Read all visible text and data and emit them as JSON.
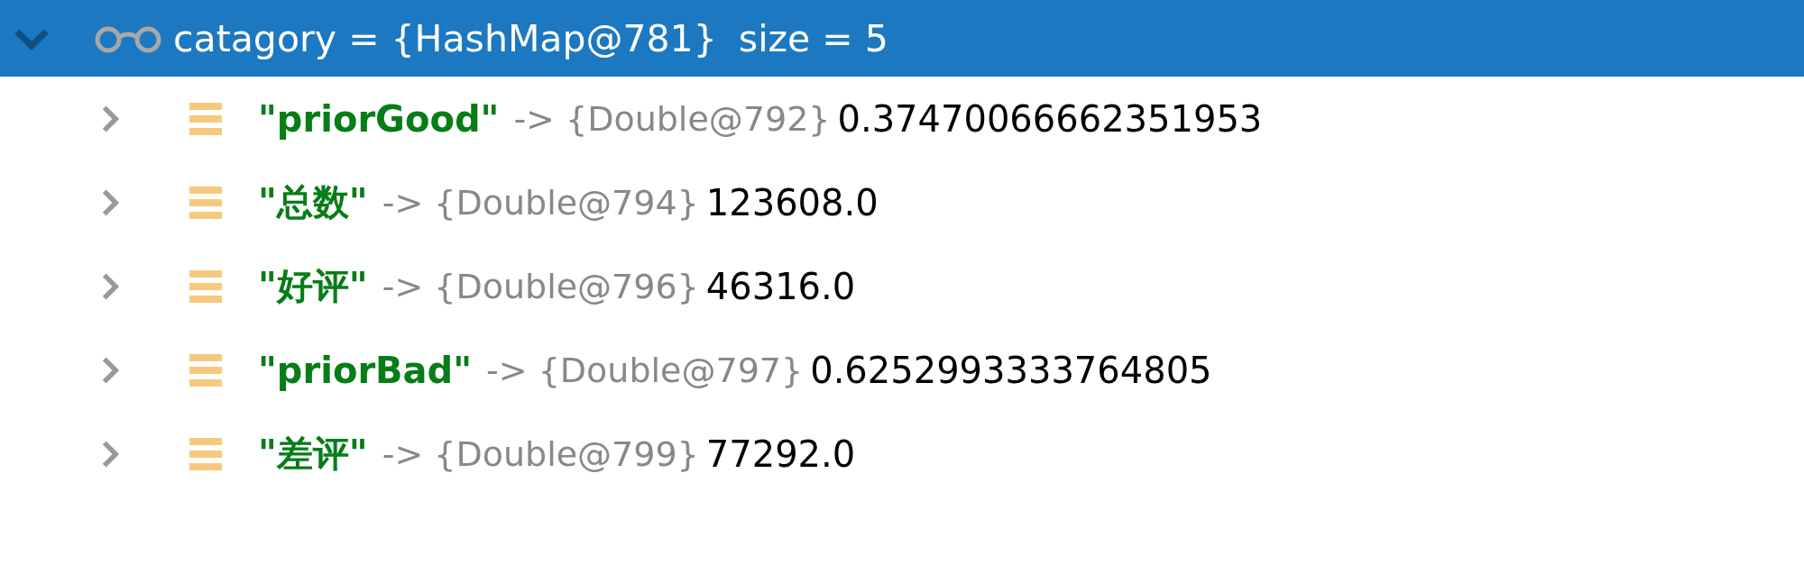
{
  "variable": {
    "label": "catagory = {HashMap@781}",
    "extra": "size = 5",
    "expanded": true,
    "selected": true,
    "children": [
      {
        "key": "\"priorGood\"",
        "arrow": "->",
        "ref": "{Double@792}",
        "value": "0.37470066662351953",
        "expanded": false
      },
      {
        "key": "\"总数\"",
        "arrow": "->",
        "ref": "{Double@794}",
        "value": "123608.0",
        "expanded": false
      },
      {
        "key": "\"好评\"",
        "arrow": "->",
        "ref": "{Double@796}",
        "value": "46316.0",
        "expanded": false
      },
      {
        "key": "\"priorBad\"",
        "arrow": "->",
        "ref": "{Double@797}",
        "value": "0.6252993333764805",
        "expanded": false
      },
      {
        "key": "\"差评\"",
        "arrow": "->",
        "ref": "{Double@799}",
        "value": "77292.0",
        "expanded": false
      }
    ]
  }
}
